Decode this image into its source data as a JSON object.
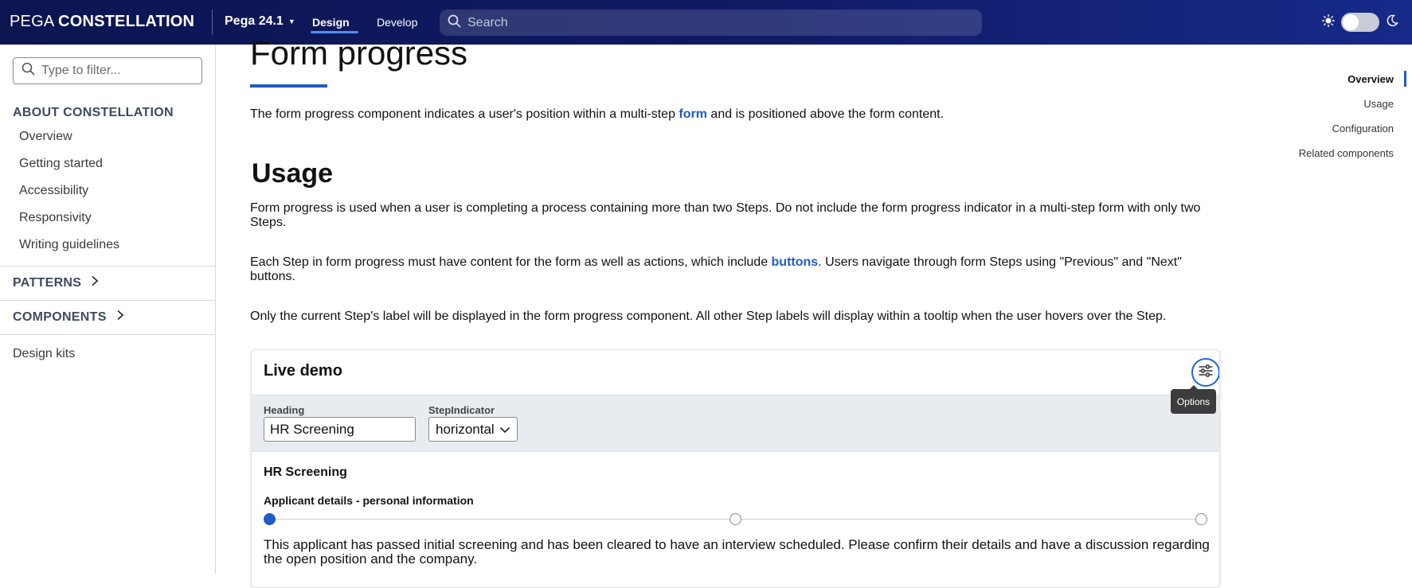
{
  "header": {
    "brand_part1": "PEGA",
    "brand_part2": "CONSTELLATION",
    "version": "Pega 24.1",
    "tabs": [
      {
        "label": "Design",
        "active": true
      },
      {
        "label": "Develop",
        "active": false
      }
    ],
    "search_placeholder": "Search",
    "theme_toggle_state": "light"
  },
  "sidebar": {
    "filter_placeholder": "Type to filter...",
    "about_title": "ABOUT CONSTELLATION",
    "about_items": [
      "Overview",
      "Getting started",
      "Accessibility",
      "Responsivity",
      "Writing guidelines"
    ],
    "patterns_label": "PATTERNS",
    "components_label": "COMPONENTS",
    "design_kits_label": "Design kits"
  },
  "main": {
    "title": "Form progress",
    "intro_before": "The form progress component indicates a user's position within a multi-step ",
    "intro_link": "form",
    "intro_after": " and is positioned above the form content.",
    "usage_heading": "Usage",
    "usage_p1": "Form progress is used when a user is completing a process containing more than two Steps. Do not include the form progress indicator in a multi-step form with only two Steps.",
    "usage_p2_before": "Each Step in form progress must have content for the form as well as actions, which include ",
    "usage_p2_link": "buttons",
    "usage_p2_after": ". Users navigate through form Steps using \"Previous\" and \"Next\" buttons.",
    "usage_p3": "Only the current Step's label will be displayed in the form progress component. All other Step labels will display within a tooltip when the user hovers over the Step."
  },
  "demo": {
    "title": "Live demo",
    "options_tooltip": "Options",
    "heading_label": "Heading",
    "heading_value": "HR Screening",
    "step_indicator_label": "StepIndicator",
    "step_indicator_value": "horizontal",
    "form_heading": "HR Screening",
    "current_step_label": "Applicant details - personal information",
    "step_count": 3,
    "current_step_index": 0,
    "body": "This applicant has passed initial screening and has been cleared to have an interview scheduled. Please confirm their details and have a discussion regarding the open position and the company."
  },
  "toc": {
    "items": [
      "Overview",
      "Usage",
      "Configuration",
      "Related components"
    ],
    "active": "Overview"
  },
  "colors": {
    "header_bg": "#101b66",
    "accent": "#1f5bc6",
    "tab_underline": "#4d8dff"
  }
}
